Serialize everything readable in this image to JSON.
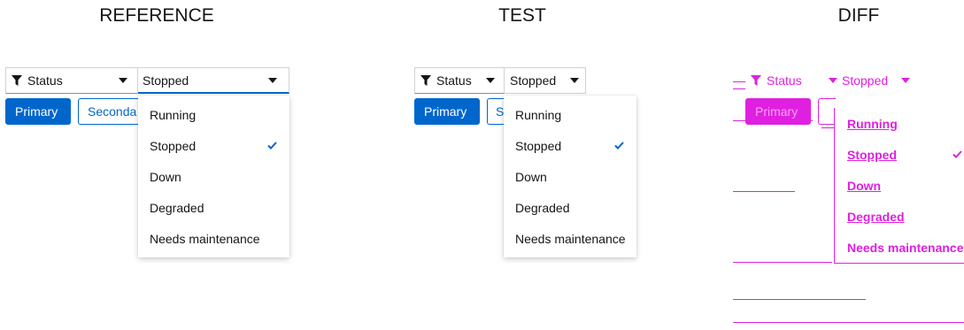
{
  "headers": {
    "reference": "REFERENCE",
    "test": "TEST",
    "diff": "DIFF"
  },
  "filter": {
    "label": "Status",
    "icon": "filter-icon"
  },
  "select": {
    "value": "Stopped",
    "icon": "caret-down-icon"
  },
  "buttons": {
    "primary": "Primary",
    "secondary_reference": "Seconda",
    "secondary_test": "S"
  },
  "menu": {
    "items": [
      "Running",
      "Stopped",
      "Down",
      "Degraded",
      "Needs maintenance"
    ],
    "selected": "Stopped",
    "check_icon": "check-icon"
  },
  "colors": {
    "accent": "#0066cc",
    "diff": "#e020e0",
    "text": "#151515",
    "border": "#d2d2d2"
  }
}
